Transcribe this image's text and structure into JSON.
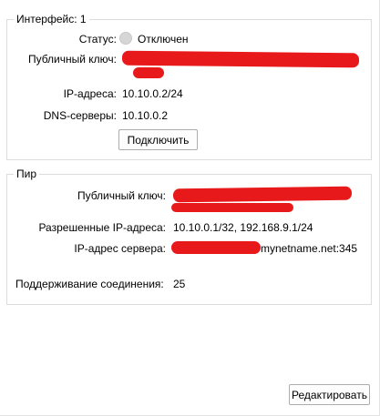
{
  "interface": {
    "title": "Интерфейс: 1",
    "status_label": "Статус:",
    "status_value": "Отключен",
    "public_key_label": "Публичный ключ:",
    "public_key_visible_tail": "=",
    "ip_label": "IP-адреса:",
    "ip_value": "10.10.0.2/24",
    "dns_label": "DNS-серверы:",
    "dns_value": "10.10.0.2",
    "connect_button": "Подключить"
  },
  "peer": {
    "title": "Пир",
    "public_key_label": "Публичный ключ:",
    "allowed_ips_label": "Разрешенные IP-адреса:",
    "allowed_ips_value": "10.10.0.1/32, 192.168.9.1/24",
    "endpoint_label": "IP-адрес сервера:",
    "endpoint_value_visible": "mynetname.net:345",
    "keepalive_label": "Поддерживание соединения:",
    "keepalive_value": "25"
  },
  "footer": {
    "edit_button": "Редактировать"
  },
  "colors": {
    "redaction": "#e8191b",
    "status_dot": "#d6d6d6",
    "group_border": "#dcdcdc"
  }
}
